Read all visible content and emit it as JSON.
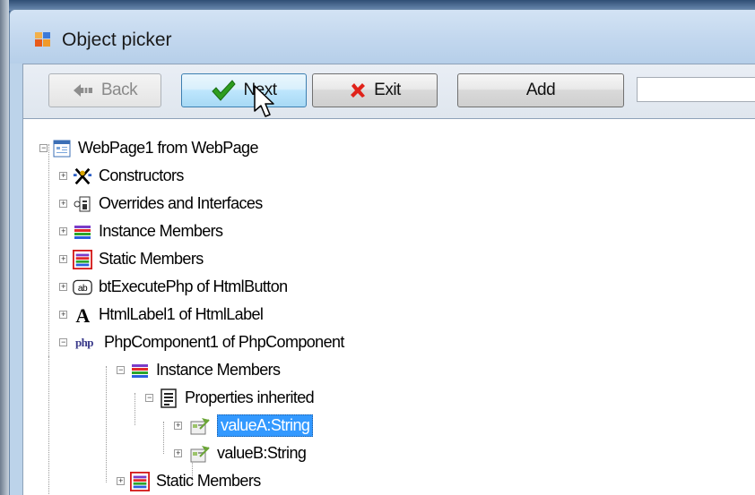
{
  "window": {
    "title": "Object picker"
  },
  "toolbar": {
    "back_label": "Back",
    "next_label": "Next",
    "exit_label": "Exit",
    "add_label": "Add",
    "search_value": ""
  },
  "tree": {
    "root": "WebPage1 from WebPage",
    "items": [
      {
        "label": "Constructors",
        "icon": "constructor-icon"
      },
      {
        "label": "Overrides and Interfaces",
        "icon": "interface-icon"
      },
      {
        "label": "Instance Members",
        "icon": "members-icon"
      },
      {
        "label": "Static Members",
        "icon": "static-members-icon"
      },
      {
        "label": "btExecutePhp of HtmlButton",
        "icon": "button-ab-icon"
      },
      {
        "label": "HtmlLabel1 of HtmlLabel",
        "icon": "label-a-icon"
      },
      {
        "label": "PhpComponent1 of PhpComponent",
        "icon": "php-icon"
      },
      {
        "label": "Instance Members",
        "icon": "members-icon"
      },
      {
        "label": "Properties inherited",
        "icon": "properties-icon"
      },
      {
        "label": "valueA:String",
        "icon": "property-icon"
      },
      {
        "label": "valueB:String",
        "icon": "property-icon"
      },
      {
        "label": "Static Members",
        "icon": "static-members-icon"
      }
    ]
  },
  "colors": {
    "selection": "#3399ff",
    "titlebar": "#c2d7ee"
  }
}
